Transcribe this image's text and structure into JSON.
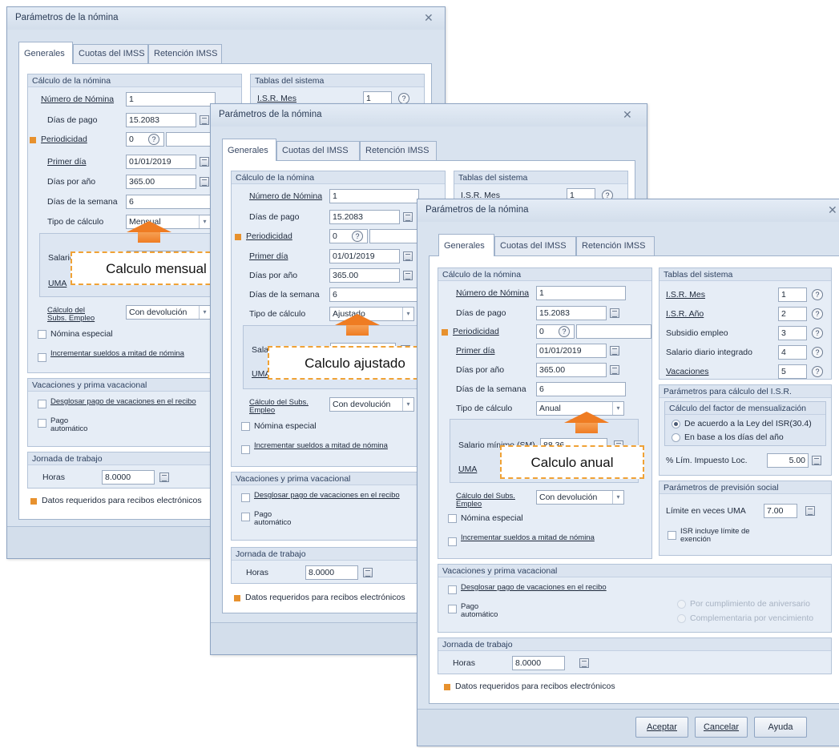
{
  "dialog": {
    "title": "Parámetros de la nómina",
    "tabs": [
      "Generales",
      "Cuotas del IMSS",
      "Retención IMSS"
    ],
    "calc_group": {
      "title": "Cálculo de la nómina",
      "numero_nomina_label": "Número de Nómina",
      "numero_nomina_value": "1",
      "dias_pago_label": "Días de pago",
      "dias_pago_value": "15.2083",
      "periodicidad_label": "Periodicidad",
      "periodicidad_value": "0",
      "primer_dia_label": "Primer día",
      "primer_dia_value": "01/01/2019",
      "dias_anio_label": "Días por año",
      "dias_anio_value": "365.00",
      "dias_semana_label": "Días de la semana",
      "dias_semana_value": "6",
      "tipo_calculo_label": "Tipo de cálculo",
      "salario_label": "Salario mínimo (SM)",
      "salario_value": "88.36",
      "uma_label": "UMA",
      "subsidio_label": "Cálculo del Subs. Empleo",
      "subsidio_value": "Con devolución",
      "nomina_especial_label": "Nómina especial",
      "incrementar_label": "Incrementar sueldos a mitad de nómina"
    },
    "vacaciones": {
      "title": "Vacaciones y prima vacacional",
      "desglosar_label": "Desglosar pago de vacaciones en el recibo",
      "pago_auto_label": "Pago automático",
      "radio_aniversario": "Por cumplimiento de aniversario",
      "radio_vencimiento": "Complementaria por vencimiento"
    },
    "jornada": {
      "title": "Jornada de trabajo",
      "horas_label": "Horas",
      "horas_value": "8.0000"
    },
    "requeridos_text": "Datos requeridos para recibos electrónicos",
    "tablas": {
      "title": "Tablas del sistema",
      "rows": [
        {
          "label": "I.S.R. Mes",
          "value": "1"
        },
        {
          "label": "I.S.R. Año",
          "value": "2"
        },
        {
          "label": "Subsidio empleo",
          "value": "3"
        },
        {
          "label": "Salario diario integrado",
          "value": "4"
        },
        {
          "label": "Vacaciones",
          "value": "5"
        }
      ]
    },
    "isr": {
      "title": "Parámetros para cálculo del I.S.R.",
      "factor_title": "Cálculo del factor de mensualización",
      "radio_ley": "De acuerdo a la Ley del ISR(30.4)",
      "radio_dias": "En base a los días del año",
      "lim_label": "% Lím. Impuesto Loc.",
      "lim_value": "5.00"
    },
    "prevision": {
      "title": "Parámetros de previsión social",
      "limite_label": "Límite en veces UMA",
      "limite_value": "7.00",
      "isr_incluye_label": "ISR incluye límite de exención"
    },
    "buttons": {
      "aceptar": "Aceptar",
      "cancelar": "Cancelar",
      "ayuda": "Ayuda"
    }
  },
  "windows": [
    {
      "tipo_calculo_value": "Mensual",
      "callout": "Calculo mensual"
    },
    {
      "tipo_calculo_value": "Ajustado",
      "callout": "Calculo ajustado"
    },
    {
      "tipo_calculo_value": "Anual",
      "callout": "Calculo anual"
    }
  ],
  "colors": {
    "accent": "#ef7c22",
    "window_bg": "#d9e3ef",
    "required_marker": "#e7912e"
  }
}
